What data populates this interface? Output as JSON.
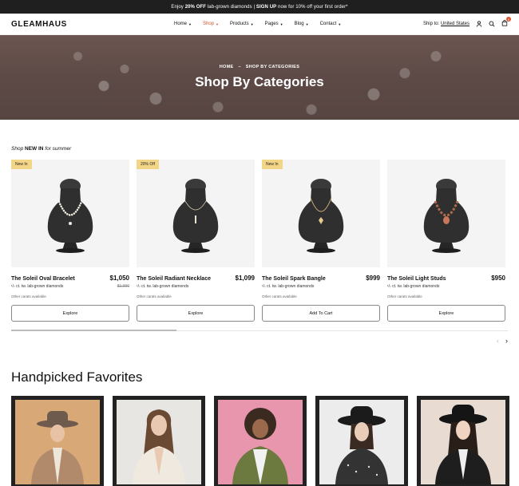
{
  "announcement": {
    "prefix": "Enjoy ",
    "highlight1": "20% OFF",
    "middle": " lab-grown diamonds | ",
    "highlight2": "SIGN UP",
    "suffix": " now for 10% off your first order*"
  },
  "header": {
    "logo": "GLEAMHAUS",
    "nav": [
      {
        "label": "Home"
      },
      {
        "label": "Shop"
      },
      {
        "label": "Products"
      },
      {
        "label": "Pages"
      },
      {
        "label": "Blog"
      },
      {
        "label": "Contact"
      }
    ],
    "ship_label": "Ship to:",
    "ship_country": "United States",
    "cart_count": "0"
  },
  "hero": {
    "crumb_home": "HOME",
    "crumb_sep": "–",
    "crumb_current": "SHOP BY CATEGORIES",
    "title": "Shop By Categories"
  },
  "new_in": {
    "prefix": "Shop ",
    "bold": "NEW IN",
    "suffix": " for summer"
  },
  "products": [
    {
      "badge": "New In",
      "title": "The Soleil Oval Bracelet",
      "price": "$1,050",
      "old_price": "$1,090",
      "carat": "¹/₇ ct. tw. lab-grown diamonds",
      "note": "Other carats available",
      "button": "Explore"
    },
    {
      "badge": "20% Off",
      "title": "The Soleil Radiant Necklace",
      "price": "$1,099",
      "old_price": "",
      "carat": "¹/₇ ct. tw. lab-grown diamonds",
      "note": "Other carats available",
      "button": "Explore"
    },
    {
      "badge": "New In",
      "title": "The Soleil Spark Bangle",
      "price": "$999",
      "old_price": "",
      "carat": "¹/₇ ct. tw. lab-grown diamonds",
      "note": "Other carats available",
      "button": "Add To Cart"
    },
    {
      "badge": "",
      "title": "The Soleil Light Studs",
      "price": "$950",
      "old_price": "",
      "carat": "¹/₇ ct. tw. lab-grown diamonds",
      "note": "Other carats available",
      "button": "Explore"
    }
  ],
  "carousel": {
    "prev": "‹",
    "next": "›"
  },
  "handpicked": {
    "title": "Handpicked Favorites",
    "photos": [
      {
        "bg": "#d9a877",
        "hat": true,
        "coat": "#b08a6a",
        "skin": "#e8c2a4"
      },
      {
        "bg": "#e7e6e2",
        "hat": false,
        "coat": "#efe9e0",
        "skin": "#e9c9b2"
      },
      {
        "bg": "#e796ad",
        "hat": false,
        "coat": "#6c7a3f",
        "skin": "#9b6a4c"
      },
      {
        "bg": "#ececec",
        "hat": true,
        "coat": "#333333",
        "skin": "#e9cdb8"
      },
      {
        "bg": "#e8dcd2",
        "hat": true,
        "coat": "#1e1e1e",
        "skin": "#f0d3c0"
      }
    ]
  },
  "colors": {
    "accent": "#d9532c",
    "badge": "#f3d587",
    "topbar": "#1f1f1f"
  }
}
